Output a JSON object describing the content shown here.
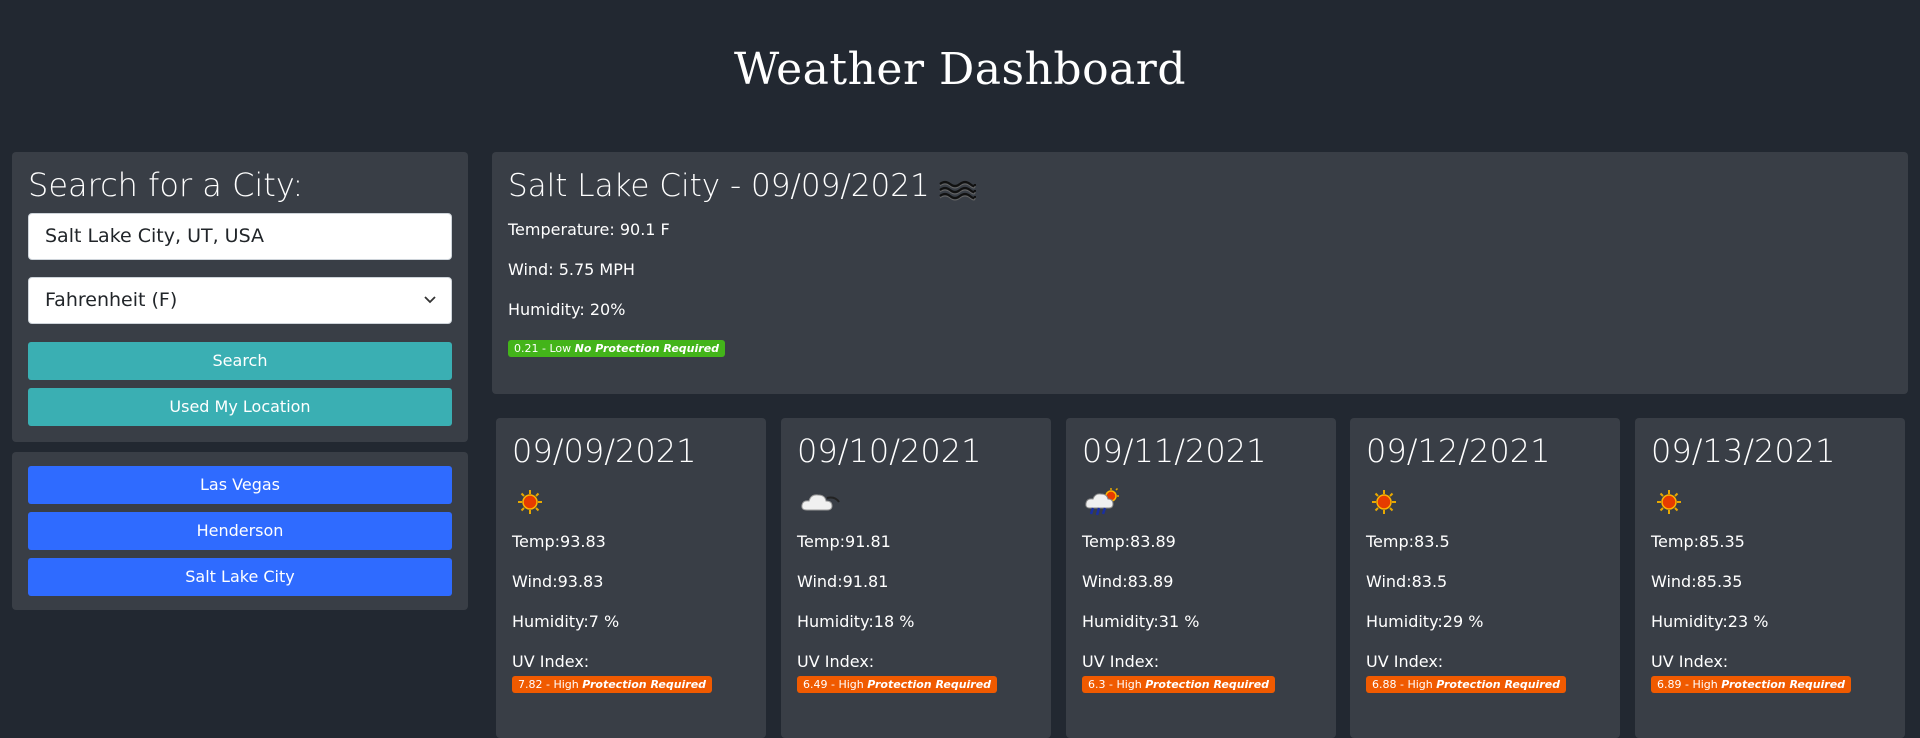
{
  "app": {
    "title": "Weather Dashboard"
  },
  "search": {
    "heading": "Search for a City:",
    "city_value": "Salt Lake City, UT, USA",
    "units_value": "Fahrenheit (F)",
    "search_label": "Search",
    "location_label": "Used My Location"
  },
  "history": [
    "Las Vegas",
    "Henderson",
    "Salt Lake City"
  ],
  "current": {
    "heading": "Salt Lake City - 09/09/2021",
    "icon": "haze-icon",
    "temperature": "Temperature: 90.1 F",
    "wind": "Wind: 5.75 MPH",
    "humidity": "Humidity: 20%",
    "uv_value": "0.21 - Low",
    "uv_note": "No Protection Required",
    "uv_level": "low"
  },
  "forecast": [
    {
      "date": "09/09/2021",
      "icon": "sun-icon",
      "temp": "Temp:93.83",
      "wind": "Wind:93.83",
      "humidity": "Humidity:7 %",
      "uv_label": "UV Index:",
      "uv_value": "7.82 - High",
      "uv_note": "Protection Required"
    },
    {
      "date": "09/10/2021",
      "icon": "cloud-icon",
      "temp": "Temp:91.81",
      "wind": "Wind:91.81",
      "humidity": "Humidity:18 %",
      "uv_label": "UV Index:",
      "uv_value": "6.49 - High",
      "uv_note": "Protection Required"
    },
    {
      "date": "09/11/2021",
      "icon": "storm-sun-icon",
      "temp": "Temp:83.89",
      "wind": "Wind:83.89",
      "humidity": "Humidity:31 %",
      "uv_label": "UV Index:",
      "uv_value": "6.3 - High",
      "uv_note": "Protection Required"
    },
    {
      "date": "09/12/2021",
      "icon": "sun-icon",
      "temp": "Temp:83.5",
      "wind": "Wind:83.5",
      "humidity": "Humidity:29 %",
      "uv_label": "UV Index:",
      "uv_value": "6.88 - High",
      "uv_note": "Protection Required"
    },
    {
      "date": "09/13/2021",
      "icon": "sun-icon",
      "temp": "Temp:85.35",
      "wind": "Wind:85.35",
      "humidity": "Humidity:23 %",
      "uv_label": "UV Index:",
      "uv_value": "6.89 - High",
      "uv_note": "Protection Required"
    }
  ],
  "colors": {
    "background": "#222831",
    "panel": "#393e46",
    "teal": "#3aafb3",
    "blue": "#2f6bff",
    "uv_low": "#43b41a",
    "uv_high": "#f05a00"
  }
}
